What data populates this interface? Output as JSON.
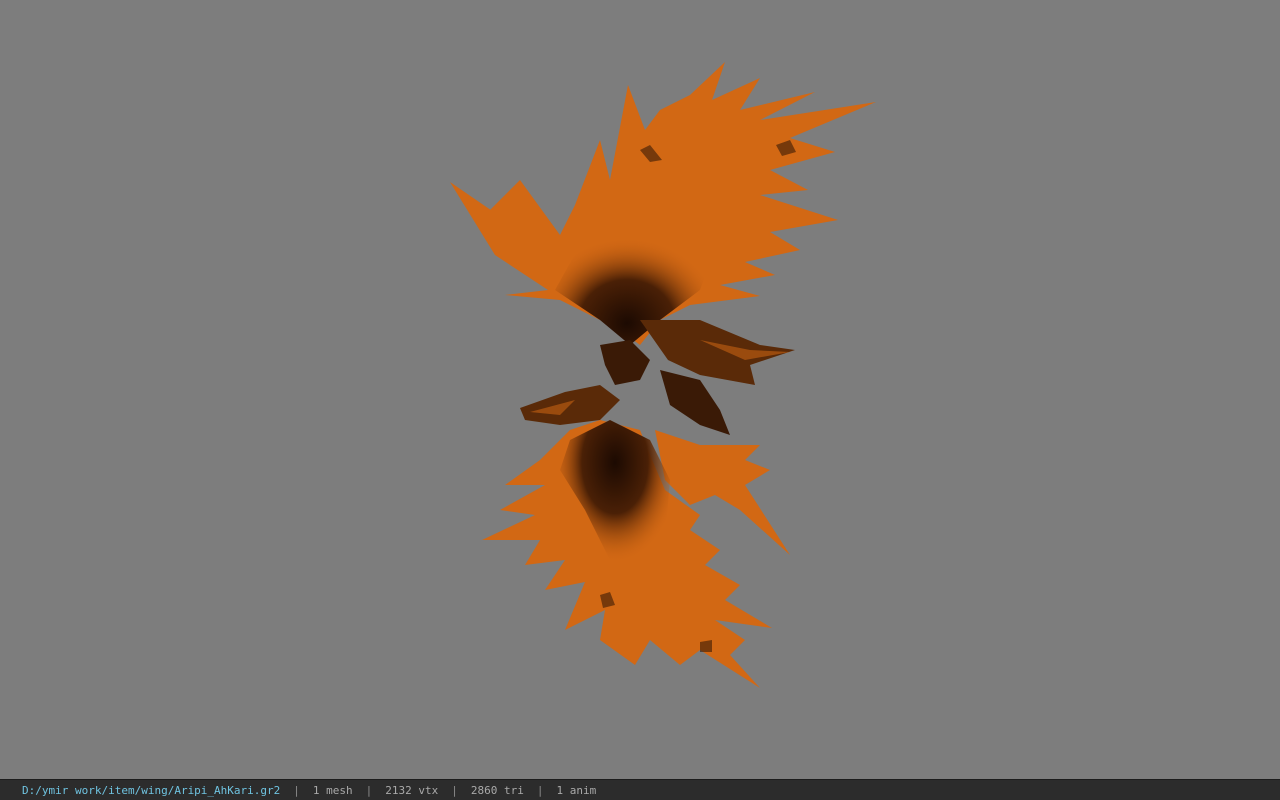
{
  "viewport": {
    "background_color": "#7d7d7d",
    "model": {
      "description_icon": "orange-wing-model",
      "primary_color": "#d86a14",
      "shadow_color": "#2a1204"
    }
  },
  "status_bar": {
    "file_path": "D:/ymir work/item/wing/Aripi_AhKari.gr2",
    "separator": "|",
    "mesh_count": "1 mesh",
    "vertex_count": "2132 vtx",
    "triangle_count": "2860 tri",
    "anim_count": "1 anim",
    "path_color": "#6fc3e0"
  }
}
